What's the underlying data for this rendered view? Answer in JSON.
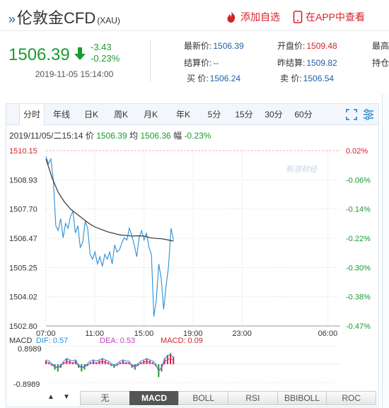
{
  "header": {
    "arrows": "»",
    "title": "伦敦金CFD",
    "code": "(XAU)",
    "add_watch": "添加自选",
    "app_view": "在APP中查看"
  },
  "quote": {
    "price": "1506.39",
    "change": "-3.43",
    "change_pct": "-0.23%",
    "time": "2019-11-05 15:14:00",
    "fields": [
      {
        "label": "最新价:",
        "value": "1506.39"
      },
      {
        "label": "开盘价:",
        "value": "1509.48"
      },
      {
        "label": "最高",
        "value": ""
      },
      {
        "label": "结算价:",
        "value": "--"
      },
      {
        "label": "昨结算:",
        "value": "1509.82"
      },
      {
        "label": "持仓",
        "value": ""
      },
      {
        "label": "买  价:",
        "value": "1506.24"
      },
      {
        "label": "卖  价:",
        "value": "1506.54"
      }
    ]
  },
  "tabs": [
    "分时",
    "年线",
    "日K",
    "周K",
    "月K",
    "年K",
    "5分",
    "15分",
    "30分",
    "60分"
  ],
  "info_line": {
    "datetime": "2019/11/05/二15:14",
    "price_label": "价",
    "price": "1506.39",
    "avg_label": "均",
    "avg": "1506.36",
    "amp_label": "幅",
    "amp": "-0.23%"
  },
  "watermark": "新浪财经",
  "chart_data": {
    "type": "line",
    "y_left_ticks": [
      "1510.15",
      "1508.93",
      "1507.70",
      "1506.47",
      "1505.25",
      "1504.02",
      "1502.80"
    ],
    "y_right_ticks": [
      "0.02%",
      "-0.06%",
      "-0.14%",
      "-0.22%",
      "-0.30%",
      "-0.38%",
      "-0.47%"
    ],
    "x_ticks": [
      "07:00",
      "11:00",
      "15:00",
      "19:00",
      "23:00",
      "06:00"
    ],
    "ylim": [
      1502.8,
      1510.15
    ],
    "x_range_hours": 24,
    "series": [
      {
        "x": [
          0,
          0.2,
          0.4,
          0.6,
          0.8,
          1.0,
          1.2,
          1.4,
          1.6,
          1.8,
          2.0,
          2.2,
          2.4,
          2.6,
          2.8,
          3.0,
          3.2,
          3.4,
          3.6,
          3.8,
          4.0,
          4.2,
          4.4,
          4.6,
          4.8,
          5.0,
          5.2,
          5.4,
          5.6,
          5.8,
          6.0,
          6.2,
          6.4,
          6.6,
          6.8,
          7.0,
          7.2,
          7.4,
          7.6,
          7.8,
          8.0,
          8.2,
          8.4,
          8.6,
          8.8,
          9.0,
          9.2,
          9.4,
          9.6,
          9.8,
          10.0,
          10.2,
          10.4
        ],
        "y": [
          1509.9,
          1509.6,
          1509.8,
          1508.9,
          1507.0,
          1506.8,
          1507.3,
          1506.5,
          1507.1,
          1506.9,
          1507.4,
          1507.6,
          1506.7,
          1507.0,
          1506.1,
          1506.3,
          1507.2,
          1506.9,
          1505.8,
          1505.6,
          1505.9,
          1505.4,
          1505.7,
          1505.3,
          1505.8,
          1505.6,
          1505.9,
          1505.4,
          1506.2,
          1505.9,
          1506.0,
          1506.3,
          1506.5,
          1506.4,
          1506.9,
          1506.6,
          1506.2,
          1505.7,
          1506.5,
          1506.8,
          1506.4,
          1506.7,
          1506.1,
          1505.8,
          1503.2,
          1503.9,
          1505.4,
          1504.8,
          1503.5,
          1504.5,
          1505.3,
          1506.9,
          1506.4
        ]
      },
      {
        "x": [
          0,
          0.5,
          1.0,
          1.5,
          2.0,
          2.5,
          3.0,
          3.5,
          4.0,
          5.0,
          6.0,
          7.0,
          7.5,
          8.0,
          8.5,
          9.0,
          9.5,
          10.0,
          10.4
        ],
        "y": [
          1509.8,
          1509.0,
          1508.4,
          1508.0,
          1507.7,
          1507.5,
          1507.3,
          1507.1,
          1506.95,
          1506.75,
          1506.62,
          1506.57,
          1506.58,
          1506.57,
          1506.5,
          1506.47,
          1506.45,
          1506.4,
          1506.36
        ]
      }
    ],
    "macd": {
      "label": "MACD",
      "dif_label": "DIF:",
      "dif": "0.57",
      "dea_label": "DEA:",
      "dea": "0.53",
      "macd_label": "MACD:",
      "macd": "0.09",
      "ymax": "0.8989",
      "ymin": "-0.8989",
      "bars": [
        0.2,
        0.1,
        -0.1,
        -0.3,
        -0.4,
        -0.2,
        0.1,
        0.3,
        0.2,
        0.1,
        0.2,
        -0.2,
        -0.4,
        -0.3,
        -0.1,
        0.1,
        0.2,
        0.1,
        0.2,
        0.3,
        0.2,
        0.1,
        -0.1,
        -0.2,
        -0.1,
        0.1,
        0.2,
        0.1,
        0.1,
        -0.2,
        -0.3,
        -0.1,
        0.1,
        0.2,
        0.3,
        0.2,
        0.1,
        -0.1,
        -0.7,
        -0.4,
        0.3,
        0.5,
        0.6,
        0.4
      ]
    }
  },
  "indicator_tabs": [
    "无",
    "MACD",
    "BOLL",
    "RSI",
    "BBIBOLL",
    "ROC"
  ],
  "colors": {
    "up": "#d3232b",
    "down": "#1a9b2e",
    "price_line": "#2a8fd6",
    "avg_line": "#333333"
  }
}
